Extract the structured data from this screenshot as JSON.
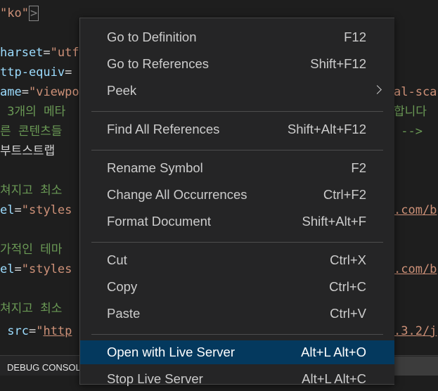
{
  "editor": {
    "lines": [
      {
        "segments": [
          {
            "t": "\"ko\"",
            "c": "str"
          },
          {
            "t": ">",
            "c": "tag",
            "box": true
          }
        ]
      },
      {
        "segments": []
      },
      {
        "segments": [
          {
            "t": "harset",
            "c": "attr"
          },
          {
            "t": "=",
            "c": "punct"
          },
          {
            "t": "\"utf",
            "c": "str"
          }
        ]
      },
      {
        "segments": [
          {
            "t": "ttp-equiv",
            "c": "attr"
          },
          {
            "t": "=",
            "c": "punct"
          }
        ]
      },
      {
        "segments": [
          {
            "t": "ame",
            "c": "attr"
          },
          {
            "t": "=",
            "c": "punct"
          },
          {
            "t": "\"viewpo",
            "c": "str"
          }
        ],
        "right": [
          {
            "t": "al-sca",
            "c": "str"
          }
        ]
      },
      {
        "segments": [
          {
            "t": " 3개의 메타",
            "c": "cmt"
          }
        ],
        "right": [
          {
            "t": "합니다",
            "c": "cmt"
          }
        ]
      },
      {
        "segments": [
          {
            "t": "른 콘텐츠들",
            "c": "cmt"
          }
        ],
        "right": [
          {
            "t": " -->",
            "c": "cmt"
          }
        ]
      },
      {
        "segments": [
          {
            "t": "부트스트랩",
            "c": "txt"
          }
        ]
      },
      {
        "segments": []
      },
      {
        "segments": [
          {
            "t": "쳐지고 최소",
            "c": "cmt"
          }
        ]
      },
      {
        "segments": [
          {
            "t": "el",
            "c": "attr"
          },
          {
            "t": "=",
            "c": "punct"
          },
          {
            "t": "\"styles",
            "c": "str"
          }
        ],
        "right": [
          {
            "t": ".com/b",
            "c": "url"
          }
        ]
      },
      {
        "segments": []
      },
      {
        "segments": [
          {
            "t": "가적인 테마",
            "c": "cmt"
          }
        ]
      },
      {
        "segments": [
          {
            "t": "el",
            "c": "attr"
          },
          {
            "t": "=",
            "c": "punct"
          },
          {
            "t": "\"styles",
            "c": "str"
          }
        ],
        "right": [
          {
            "t": ".com/b",
            "c": "url"
          }
        ]
      },
      {
        "segments": []
      },
      {
        "segments": [
          {
            "t": "쳐지고 최소",
            "c": "cmt"
          }
        ]
      },
      {
        "segments": [
          {
            "t": " src",
            "c": "attr"
          },
          {
            "t": "=",
            "c": "punct"
          },
          {
            "t": "\"",
            "c": "str"
          },
          {
            "t": "http",
            "c": "url"
          }
        ],
        "right": [
          {
            "t": ".3.2/j",
            "c": "url"
          }
        ]
      }
    ]
  },
  "panel": {
    "tab_label": "DEBUG CONSOLE"
  },
  "context_menu": {
    "items": [
      {
        "id": "go-to-definition",
        "label": "Go to Definition",
        "shortcut": "F12"
      },
      {
        "id": "go-to-references",
        "label": "Go to References",
        "shortcut": "Shift+F12"
      },
      {
        "id": "peek",
        "label": "Peek",
        "shortcut": "",
        "submenu": true
      },
      {
        "separator": true
      },
      {
        "id": "find-all-references",
        "label": "Find All References",
        "shortcut": "Shift+Alt+F12"
      },
      {
        "separator": true
      },
      {
        "id": "rename-symbol",
        "label": "Rename Symbol",
        "shortcut": "F2"
      },
      {
        "id": "change-all-occurrences",
        "label": "Change All Occurrences",
        "shortcut": "Ctrl+F2"
      },
      {
        "id": "format-document",
        "label": "Format Document",
        "shortcut": "Shift+Alt+F"
      },
      {
        "separator": true
      },
      {
        "id": "cut",
        "label": "Cut",
        "shortcut": "Ctrl+X"
      },
      {
        "id": "copy",
        "label": "Copy",
        "shortcut": "Ctrl+C"
      },
      {
        "id": "paste",
        "label": "Paste",
        "shortcut": "Ctrl+V"
      },
      {
        "separator": true
      },
      {
        "id": "open-with-live-server",
        "label": "Open with Live Server",
        "shortcut": "Alt+L Alt+O",
        "active": true
      },
      {
        "id": "stop-live-server",
        "label": "Stop Live Server",
        "shortcut": "Alt+L Alt+C"
      }
    ]
  }
}
